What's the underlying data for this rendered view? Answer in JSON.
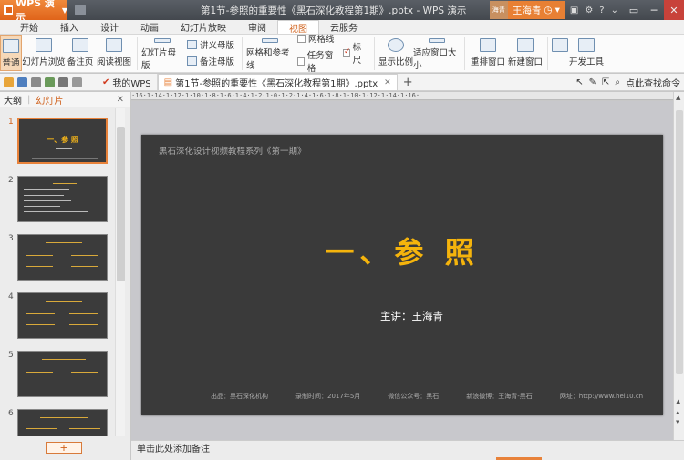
{
  "app": {
    "wps_button": "WPS 演示",
    "document_title": "第1节-参照的重要性《黑石深化教程第1期》.pptx - WPS 演示",
    "avatar_text": "海青",
    "username": "王海青"
  },
  "menu": {
    "tabs": [
      "开始",
      "插入",
      "设计",
      "动画",
      "幻灯片放映",
      "审阅",
      "视图",
      "云服务"
    ],
    "active": "视图"
  },
  "ribbon": {
    "normal": "普通",
    "slide_sorter": "幻灯片浏览",
    "notes_page": "备注页",
    "reading_view": "阅读视图",
    "slide_master": "幻灯片母版",
    "handout_master": "讲义母版",
    "notes_master": "备注母版",
    "grid_guides": "网格和参考线",
    "gridlines": "网格线",
    "ruler": "标尺",
    "task_pane": "任务窗格",
    "zoom": "显示比例",
    "fit_window": "适应窗口大小",
    "arrange": "重排窗口",
    "new_window": "新建窗口",
    "dev_tools": "开发工具",
    "ruler_checked": true,
    "gridlines_checked": false,
    "task_pane_checked": false
  },
  "toolbar2": {
    "my_wps_tab": "我的WPS",
    "doc_tab": "第1节-参照的重要性《黑石深化教程第1期》.pptx",
    "right_text": "点此查找命令"
  },
  "leftpanel": {
    "outline_tab": "大纲",
    "slides_tab": "幻灯片",
    "slide_numbers": [
      "1",
      "2",
      "3",
      "4",
      "5",
      "6"
    ],
    "slide1_title": "一、参 照",
    "slide2_title": "第一章 · 参照物概念"
  },
  "ruler_text": "·16·1·14·1·12·1·10·1·8·1·6·1·4·1·2·1·0·1·2·1·4·1·6·1·8·1·10·1·12·1·14·1·16·",
  "slide": {
    "series": "黑石深化设计视频教程系列《第一期》",
    "title": "一、参 照",
    "presenter": "主讲：王海青",
    "footer": [
      "出品：黑石深化机构",
      "录制时间：2017年5月",
      "微信公众号：黑石",
      "新浪微博：王海青-黑石",
      "网址：http://www.hei10.cn"
    ]
  },
  "notes_placeholder": "单击此处添加备注",
  "colors": {
    "accent": "#e8823a",
    "slide_bg": "#3a3a3a",
    "title_gold": "#f5b40c"
  }
}
